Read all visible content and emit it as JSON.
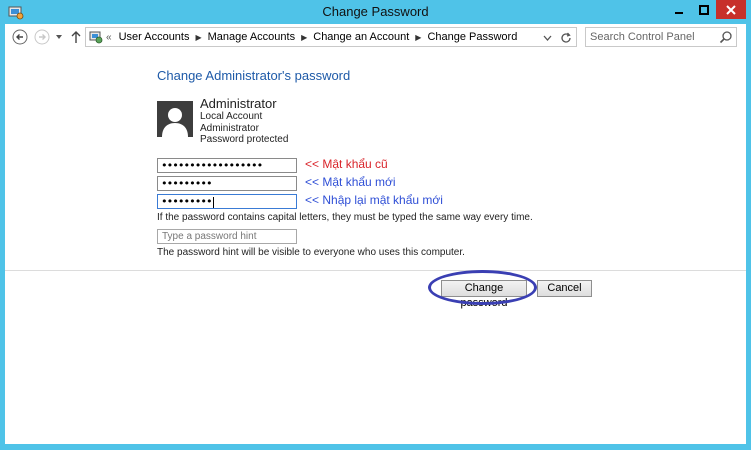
{
  "window": {
    "title": "Change Password",
    "accent_color": "#4fc3e8",
    "close_color": "#c7302a"
  },
  "nav": {
    "breadcrumb_prefix": "«",
    "breadcrumbs": [
      "User Accounts",
      "Manage Accounts",
      "Change an Account",
      "Change Password"
    ],
    "search_placeholder": "Search Control Panel"
  },
  "content": {
    "heading": "Change Administrator's password",
    "account": {
      "name": "Administrator",
      "type": "Local Account",
      "group": "Administrator",
      "status": "Password protected"
    },
    "fields": {
      "current_password": "••••••••••••••••••",
      "new_password": "•••••••••",
      "confirm_password": "•••••••••"
    },
    "annotations": {
      "current": "<< Mật khẩu cũ",
      "new": "<< Mật khẩu mới",
      "confirm": "<< Nhập lại mật khẩu mới"
    },
    "capital_letters_note": "If the password contains capital letters, they must be typed the same way every time.",
    "hint_placeholder": "Type a password hint",
    "hint_note": "The password hint will be visible to everyone who uses this computer."
  },
  "buttons": {
    "change": "Change password",
    "cancel": "Cancel"
  }
}
